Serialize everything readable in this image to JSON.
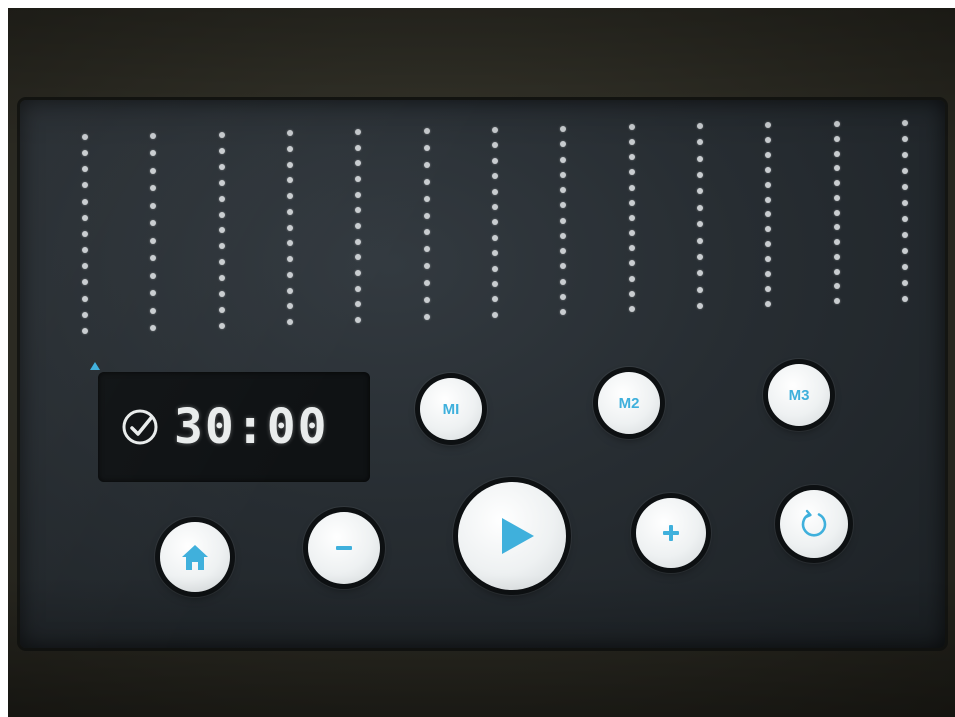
{
  "timer": {
    "value": "30:00",
    "status_icon": "check-circle-icon"
  },
  "level_meter": {
    "columns": [
      {
        "dots": 13,
        "has_marker": true
      },
      {
        "dots": 12
      },
      {
        "dots": 13
      },
      {
        "dots": 13
      },
      {
        "dots": 13
      },
      {
        "dots": 12
      },
      {
        "dots": 13
      },
      {
        "dots": 13
      },
      {
        "dots": 13
      },
      {
        "dots": 12
      },
      {
        "dots": 13
      },
      {
        "dots": 13
      },
      {
        "dots": 12
      }
    ],
    "marker_column": 1
  },
  "memory_buttons": {
    "m1_label": "MI",
    "m2_label": "M2",
    "m3_label": "M3"
  },
  "controls": {
    "home_icon": "home-icon",
    "minus_icon": "minus-icon",
    "play_icon": "play-icon",
    "plus_icon": "plus-icon",
    "reset_icon": "reset-icon"
  },
  "colors": {
    "accent": "#3fb0dc",
    "screen_bg": "#272d32",
    "button_face": "#eef1f2",
    "dot": "#c9cdd0",
    "timer_text": "#e9ecec"
  }
}
